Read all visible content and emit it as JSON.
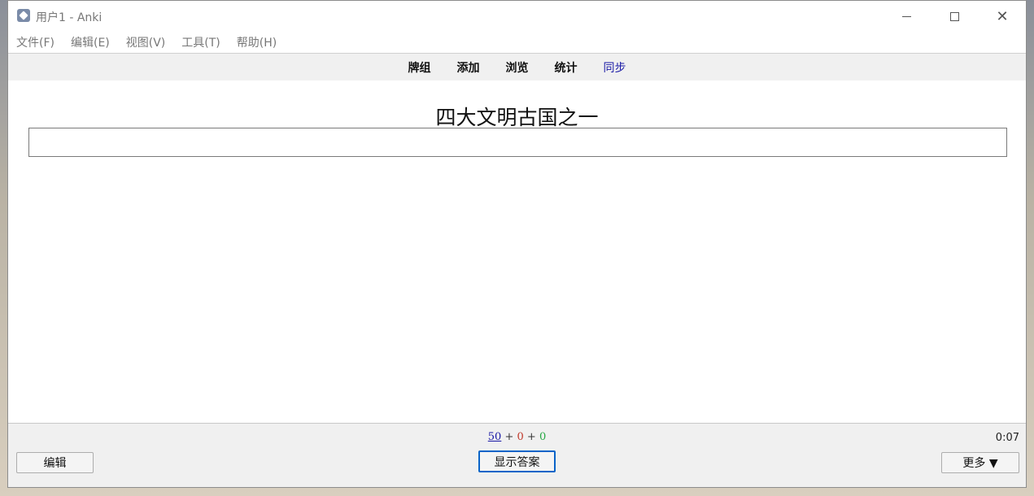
{
  "window": {
    "title": "用户1 - Anki",
    "controls": {
      "minimize": "minimize-icon",
      "maximize": "maximize-icon",
      "close": "close-icon"
    }
  },
  "menu": [
    {
      "label": "文件(F)"
    },
    {
      "label": "编辑(E)"
    },
    {
      "label": "视图(V)"
    },
    {
      "label": "工具(T)"
    },
    {
      "label": "帮助(H)"
    }
  ],
  "toolbar": {
    "decks": "牌组",
    "add": "添加",
    "browse": "浏览",
    "stats": "统计",
    "sync": "同步"
  },
  "card": {
    "question": "四大文明古国之一",
    "answer_value": ""
  },
  "bottom": {
    "count_new": "50",
    "count_learn": "0",
    "count_due": "0",
    "separator": "+",
    "timer": "0:07",
    "edit_label": "编辑",
    "show_answer_label": "显示答案",
    "more_label": "更多 ▼"
  },
  "colors": {
    "sync_link": "#1a1aa6",
    "count_new": "#1a1aa6",
    "count_learn": "#c0392b",
    "count_due": "#27a844",
    "show_answer_border": "#0a64c8"
  }
}
